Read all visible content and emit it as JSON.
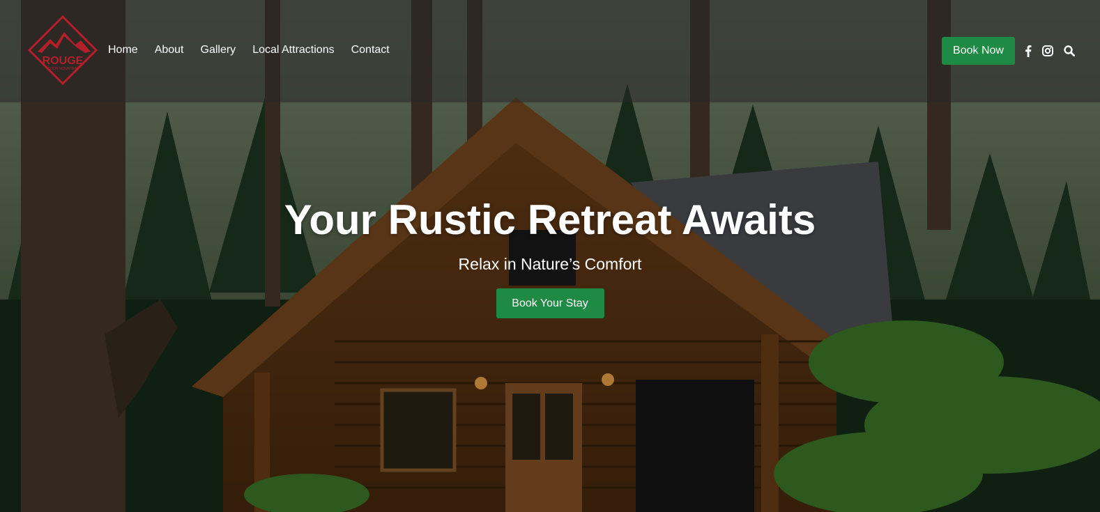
{
  "brand": {
    "logo_text": "ROUGE",
    "logo_subtext": "COON MOUNTAIN",
    "logo_color": "#b3202a"
  },
  "nav": {
    "items": [
      {
        "label": "Home"
      },
      {
        "label": "About"
      },
      {
        "label": "Gallery"
      },
      {
        "label": "Local Attractions"
      },
      {
        "label": "Contact"
      }
    ]
  },
  "header": {
    "book_label": "Book Now",
    "social_icons": [
      "facebook-icon",
      "instagram-icon",
      "search-icon"
    ]
  },
  "hero": {
    "title": "Your Rustic Retreat Awaits",
    "subtitle": "Relax in Nature’s Comfort",
    "cta_label": "Book Your Stay"
  },
  "colors": {
    "accent": "#1e8a43",
    "text": "#ffffff",
    "topbar": "#282828"
  }
}
